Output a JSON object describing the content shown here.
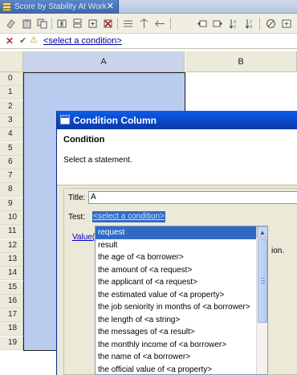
{
  "editor_tab": {
    "title": "Score by Stability At Work",
    "close_glyph": "✕",
    "icon": "table-icon"
  },
  "toolbar": {
    "icons": [
      "eraser-icon",
      "paste-icon",
      "copy-icon",
      "insert-column-icon",
      "insert-row-icon",
      "delete-icon",
      "align-icon",
      "split-icon",
      "merge-icon",
      "move-left-icon",
      "move-right-icon",
      "sort-ascending-icon",
      "sort-descending-icon",
      "filter-icon",
      "disable-icon",
      "add-icon",
      "check-icon"
    ]
  },
  "condition_bar": {
    "cancel_glyph": "✕",
    "apply_glyph": "✔",
    "warning_glyph": "⚠",
    "link": "<select a condition>"
  },
  "grid": {
    "columns": [
      "A",
      "B"
    ],
    "rows": [
      "0",
      "1",
      "2",
      "3",
      "4",
      "5",
      "6",
      "7",
      "8",
      "9",
      "10",
      "11",
      "12",
      "13",
      "14",
      "15",
      "16",
      "17",
      "18",
      "19"
    ]
  },
  "dialog": {
    "window_title": "Condition Column",
    "header_title": "Condition",
    "header_subtitle": "Select a statement.",
    "title_label": "Title:",
    "title_value": "A",
    "test_label": "Test:",
    "test_value": "<select a condition>",
    "value_link_partial": "Value(s",
    "partial_text": "ion."
  },
  "dropdown": {
    "items": [
      "request",
      "result",
      "the age of <a borrower>",
      "the amount of <a request>",
      "the applicant of <a request>",
      "the estimated value of <a property>",
      "the job seniority in months of <a borrower>",
      "the length of <a string>",
      "the messages of <a result>",
      "the monthly income of <a borrower>",
      "the name of <a borrower>",
      "the official value of <a property>"
    ],
    "selected_index": 0
  },
  "colors": {
    "title_bar": "#0845c6",
    "selection": "#316ac5",
    "column_selection": "#b9cbee",
    "link": "#00009c"
  }
}
